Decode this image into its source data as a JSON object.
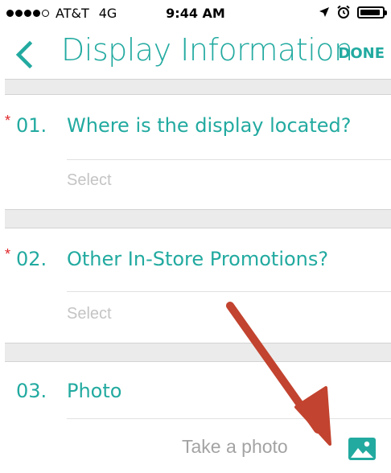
{
  "status": {
    "carrier": "AT&T",
    "network": "4G",
    "time": "9:44 AM"
  },
  "header": {
    "title": "Display Information",
    "done_label": "DONE"
  },
  "questions": [
    {
      "required_mark": "*",
      "number": "01.",
      "text": "Where is the display located?",
      "placeholder": "Select"
    },
    {
      "required_mark": "*",
      "number": "02.",
      "text": "Other In-Store Promotions?",
      "placeholder": "Select"
    },
    {
      "required_mark": "",
      "number": "03.",
      "text": "Photo",
      "action_label": "Take a photo"
    }
  ],
  "colors": {
    "accent": "#22aaa0",
    "required": "#e0262a",
    "annotation_arrow": "#c2432f"
  },
  "icons": {
    "back": "chevron-left-icon",
    "location": "location-arrow-icon",
    "alarm": "alarm-clock-icon",
    "battery": "battery-icon",
    "photo": "image-icon"
  }
}
